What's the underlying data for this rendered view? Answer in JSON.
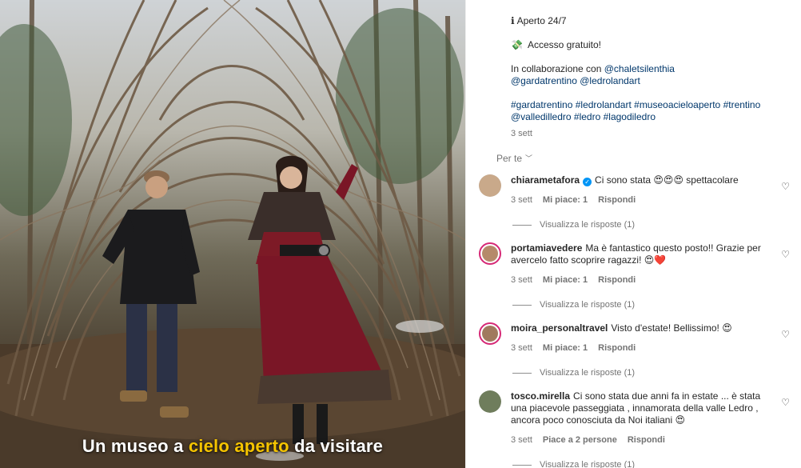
{
  "media": {
    "caption_parts": [
      "Un museo a ",
      "cielo aperto",
      " da visitare"
    ]
  },
  "post": {
    "line_open": "Aperto 24/7",
    "line_free": "Accesso gratuito!",
    "collab_prefix": "In collaborazione con ",
    "collab_tags": [
      "@chaletsilenthia",
      "@gardatrentino",
      "@ledrolandart"
    ],
    "hashtags": [
      "#gardatrentino",
      "#ledrolandart",
      "#museoacieloaperto",
      "#trentino",
      "@valledilledro",
      "#ledro",
      "#lagodiledro"
    ],
    "time": "3 sett",
    "audience": "Per te"
  },
  "comments": [
    {
      "user": "chiarametafora",
      "verified": true,
      "text": "Ci sono stata 😍😍😍 spettacolare",
      "time": "3 sett",
      "likes": "Mi piace: 1",
      "reply": "Rispondi",
      "view_replies": "Visualizza le risposte (1)",
      "avatar_color": "#c9a98a"
    },
    {
      "user": "portamiavedere",
      "verified": false,
      "text": "Ma è fantastico questo posto!! Grazie per avercelo fatto scoprire ragazzi! 😍❤️",
      "time": "3 sett",
      "likes": "Mi piace: 1",
      "reply": "Rispondi",
      "view_replies": "Visualizza le risposte (1)",
      "avatar_color": "#b58a6a"
    },
    {
      "user": "moira_personaltravel",
      "verified": false,
      "text": "Visto d'estate! Bellissimo! 😍",
      "time": "3 sett",
      "likes": "Mi piace: 1",
      "reply": "Rispondi",
      "view_replies": "Visualizza le risposte (1)",
      "avatar_color": "#a07a5e"
    },
    {
      "user": "tosco.mirella",
      "verified": false,
      "text": "Ci sono stata due anni fa in estate ... è stata una piacevole passeggiata , innamorata della valle Ledro , ancora poco conosciuta da Noi italiani 😍",
      "time": "3 sett",
      "likes": "Piace a 2 persone",
      "reply": "Rispondi",
      "view_replies": "Visualizza le risposte (1)",
      "avatar_color": "#6f7d5c"
    }
  ],
  "colors": {
    "link": "#00376b",
    "muted": "#737373",
    "verified": "#0095f6",
    "caption_highlight": "#f5c400",
    "avatar_ring": "#d62976"
  },
  "icons": {
    "info": "info-icon",
    "money": "money-icon",
    "chevron": "chevron-down-icon",
    "like": "heart-icon",
    "verified": "verified-icon"
  }
}
